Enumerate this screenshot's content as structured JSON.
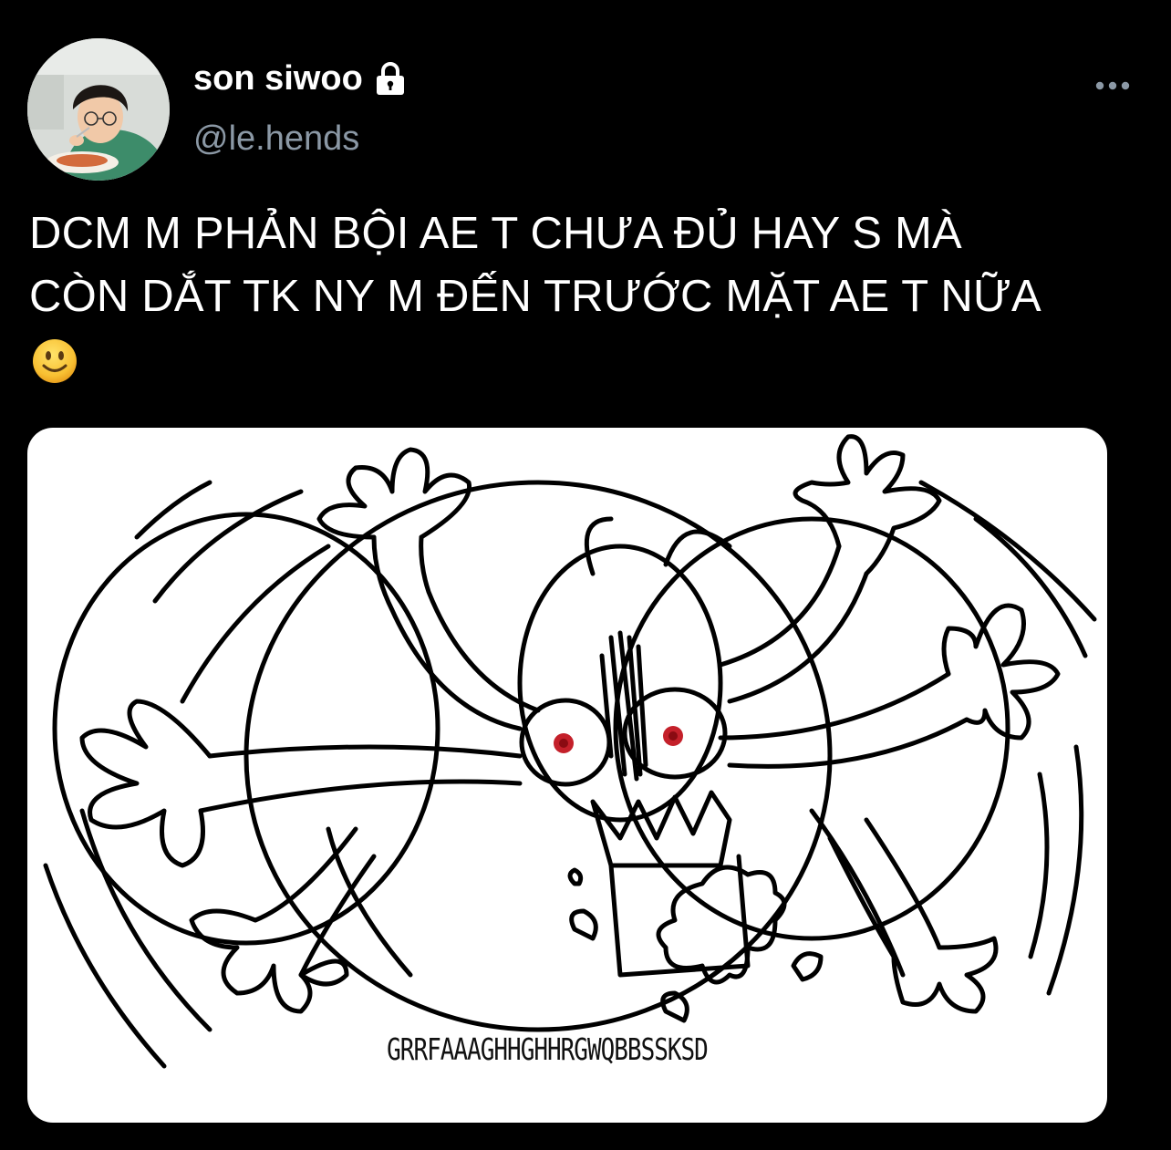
{
  "tweet": {
    "author": {
      "display_name": "son siwoo",
      "handle": "@le.hends",
      "protected_icon": "lock-icon",
      "avatar_icon": "profile-photo"
    },
    "more_icon": "more-horizontal-icon",
    "text_lines": [
      "DCM M PHẢN BỘI AE T CHƯA ĐỦ HAY S MÀ",
      "CÒN DẮT TK NY M ĐẾN TRƯỚC MẶT AE T NỮA"
    ],
    "emoji": "🙂",
    "media": {
      "image_icon": "angry-doodle-illustration",
      "caption": "GRRFAAAGHHGHHRGWQBBSSKSD"
    }
  },
  "colors": {
    "background": "#000000",
    "primary_text": "#ffffff",
    "secondary_text": "#8b98a5",
    "media_background": "#ffffff"
  }
}
